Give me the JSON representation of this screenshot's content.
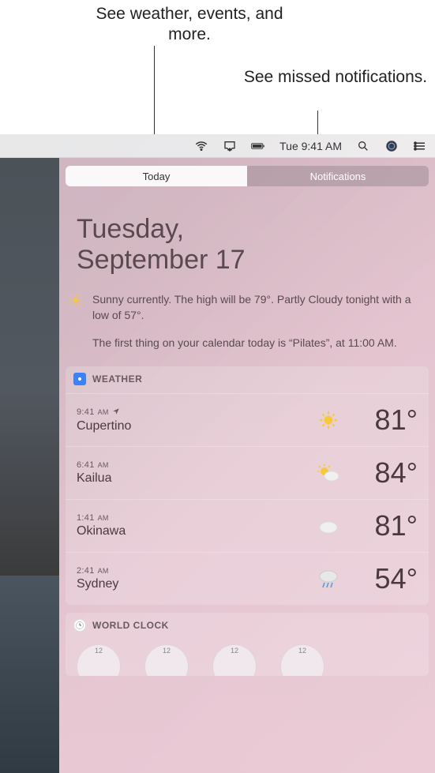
{
  "callouts": {
    "today": "See weather, events, and more.",
    "notifications": "See missed notifications."
  },
  "menubar": {
    "clock": "Tue 9:41 AM"
  },
  "tabs": {
    "today": "Today",
    "notifications": "Notifications"
  },
  "heading": {
    "line1": "Tuesday,",
    "line2": "September 17"
  },
  "summary": {
    "weather": "Sunny currently. The high will be 79°. Partly Cloudy tonight with a low of 57°.",
    "calendar": "The first thing on your calendar today is “Pilates”, at 11:00 AM."
  },
  "weather_widget": {
    "title": "WEATHER",
    "rows": [
      {
        "time": "9:41",
        "ampm": "AM",
        "location_marker": true,
        "city": "Cupertino",
        "icon": "sun",
        "temp": "81°"
      },
      {
        "time": "6:41",
        "ampm": "AM",
        "location_marker": false,
        "city": "Kailua",
        "icon": "sun-cloud",
        "temp": "84°"
      },
      {
        "time": "1:41",
        "ampm": "AM",
        "location_marker": false,
        "city": "Okinawa",
        "icon": "cloud",
        "temp": "81°"
      },
      {
        "time": "2:41",
        "ampm": "AM",
        "location_marker": false,
        "city": "Sydney",
        "icon": "rain",
        "temp": "54°"
      }
    ]
  },
  "worldclock_widget": {
    "title": "WORLD CLOCK",
    "top_number": "12"
  }
}
